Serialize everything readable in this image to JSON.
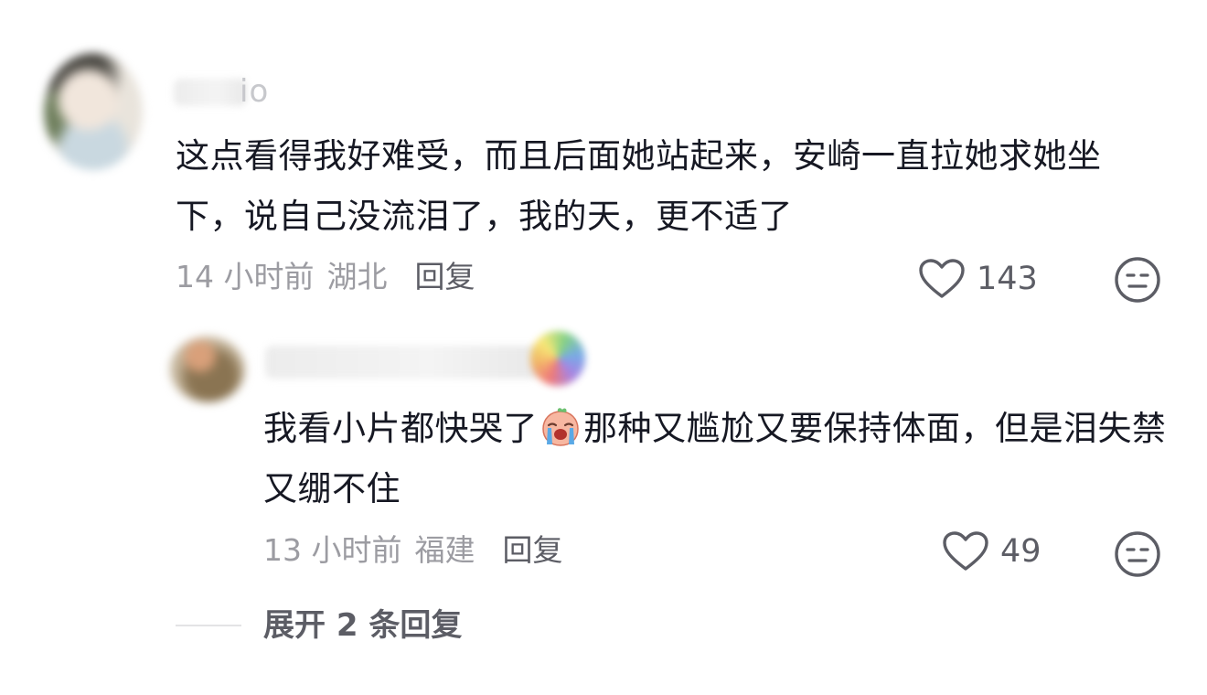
{
  "comments": [
    {
      "username_visible": "io",
      "text": "这点看得我好难受，而且后面她站起来，安崎一直拉她求她坐下，说自己没流泪了，我的天，更不适了",
      "time": "14 小时前",
      "location": "湖北",
      "reply_label": "回复",
      "likes": "143"
    },
    {
      "text_before_emoji": "我看小片都快哭了",
      "emoji": "crying-face-emoji",
      "text_after_emoji": "那种又尴尬又要保持体面，但是泪失禁又绷不住",
      "time": "13 小时前",
      "location": "福建",
      "reply_label": "回复",
      "likes": "49"
    }
  ],
  "expand_replies_label": "展开 2 条回复",
  "colors": {
    "text": "#161823",
    "meta": "#9c9ca2",
    "action": "#5c5d65"
  },
  "icons": {
    "like": "heart-outline-icon",
    "dislike": "neutral-face-icon"
  }
}
